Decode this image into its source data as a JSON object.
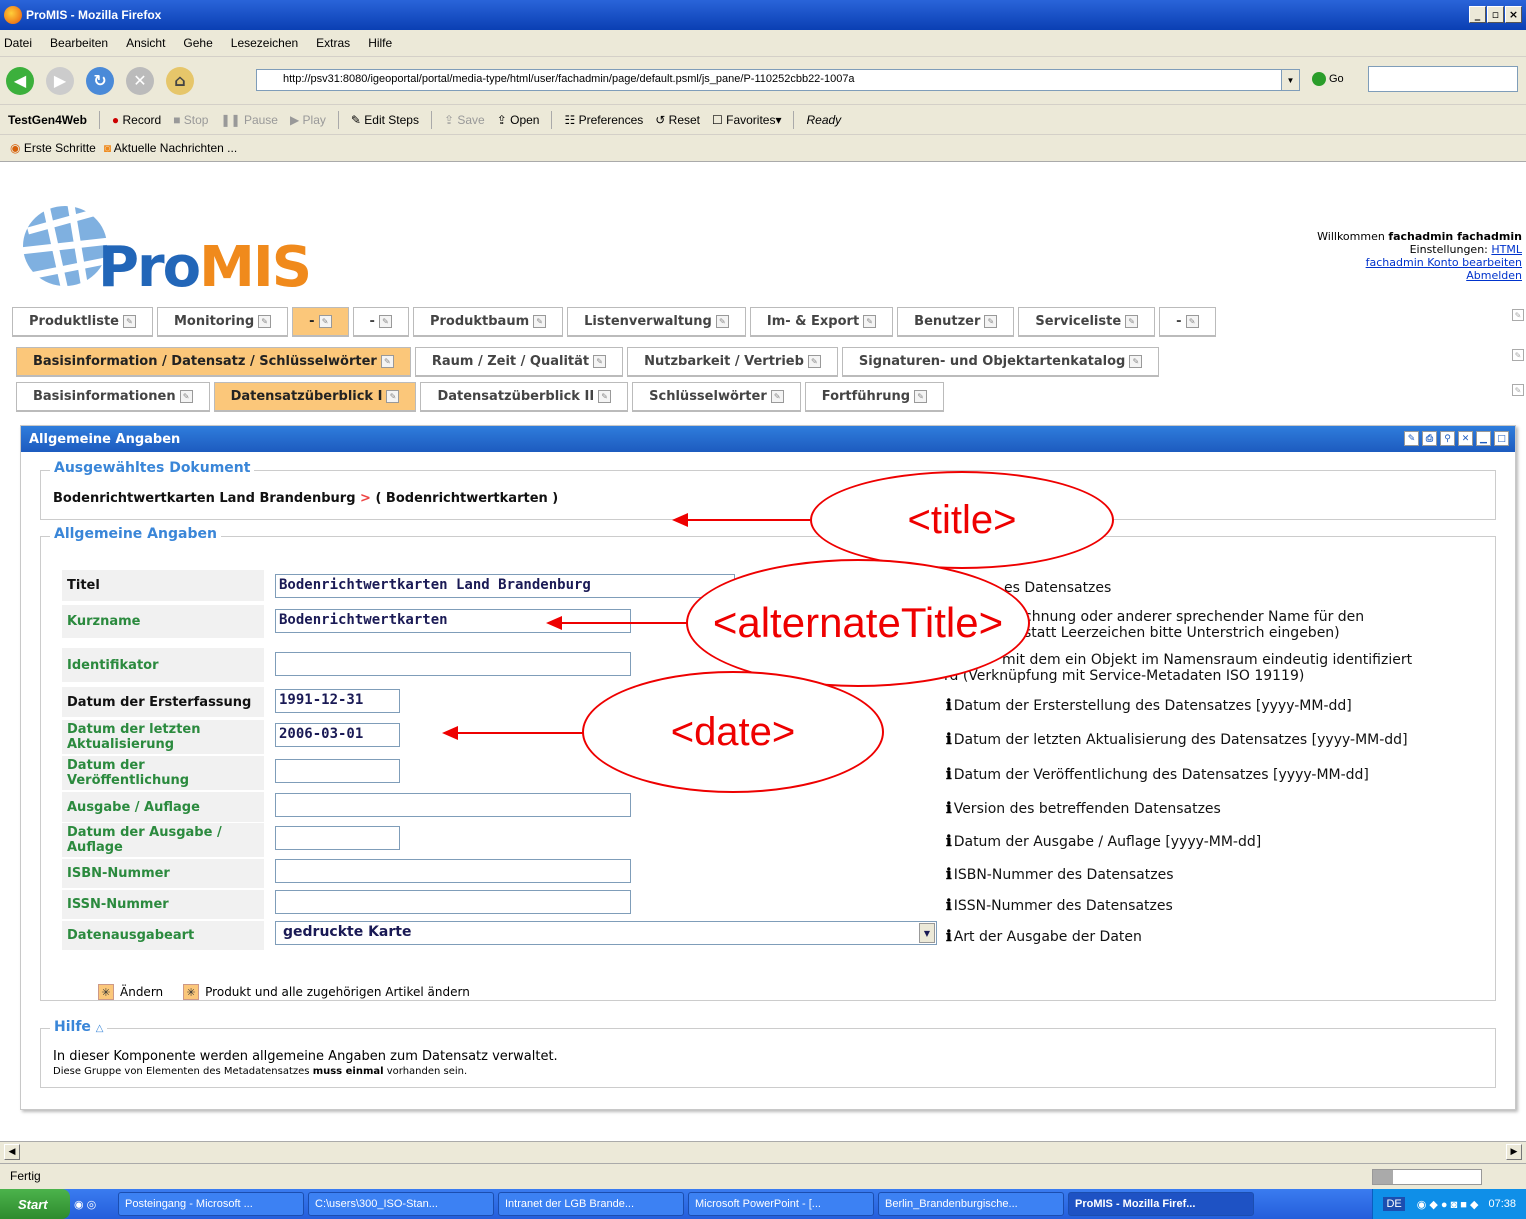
{
  "browser": {
    "title": "ProMIS - Mozilla Firefox",
    "menu": [
      "Datei",
      "Bearbeiten",
      "Ansicht",
      "Gehe",
      "Lesezeichen",
      "Extras",
      "Hilfe"
    ],
    "url": "http://psv31:8080/igeoportal/portal/media-type/html/user/fachadmin/page/default.psml/js_pane/P-110252cbb22-1007a",
    "go_label": "Go",
    "testgen": {
      "name": "TestGen4Web",
      "record": "Record",
      "stop": "Stop",
      "pause": "Pause",
      "play": "Play",
      "edit_steps": "Edit Steps",
      "save": "Save",
      "open": "Open",
      "preferences": "Preferences",
      "reset": "Reset",
      "favorites": "Favorites▾",
      "status": "Ready"
    },
    "bookmarks": [
      "Erste Schritte",
      "Aktuelle Nachrichten ..."
    ],
    "status": "Fertig"
  },
  "app": {
    "logo_pre": "Pro",
    "logo_post": "MIS",
    "welcome_prefix": "Willkommen ",
    "welcome_user": "fachadmin fachadmin",
    "settings_prefix": "Einstellungen: ",
    "settings_link": "HTML",
    "account_link": "fachadmin Konto bearbeiten",
    "logout_link": "Abmelden"
  },
  "tabs1": [
    "Produktliste",
    "Monitoring",
    "-",
    "-",
    "Produktbaum",
    "Listenverwaltung",
    "Im- & Export",
    "Benutzer",
    "Serviceliste",
    "-"
  ],
  "tabs2": [
    "Basisinformation / Datensatz / Schlüsselwörter",
    "Raum / Zeit / Qualität",
    "Nutzbarkeit / Vertrieb",
    "Signaturen- und Objektartenkatalog"
  ],
  "tabs3": [
    "Basisinformationen",
    "Datensatzüberblick I",
    "Datensatzüberblick II",
    "Schlüsselwörter",
    "Fortführung"
  ],
  "panel": {
    "title": "Allgemeine Angaben",
    "selected_legend": "Ausgewähltes Dokument",
    "doc_title": "Bodenrichtwertkarten Land Brandenburg",
    "doc_sep": ">",
    "doc_sub": "( Bodenrichtwertkarten )",
    "general_legend": "Allgemeine Angaben",
    "fields": [
      {
        "label": "Titel",
        "value": "Bodenrichtwertkarten Land Brandenburg",
        "hint": "es Datensatzes"
      },
      {
        "label": "Kurzname",
        "value": "Bodenrichtwertkarten",
        "hint1": "chnung oder anderer sprechender Name für den",
        "hint2": "statt Leerzeichen bitte Unterstrich eingeben)"
      },
      {
        "label": "Identifikator",
        "value": "",
        "hint1": "mit dem ein Objekt im Namensraum eindeutig identifiziert",
        "hint2": "rd (Verknüpfung mit Service-Metadaten ISO 19119)"
      },
      {
        "label": "Datum der Ersterfassung",
        "value": "1991-12-31",
        "hint": "Datum der Ersterstellung des Datensatzes [yyyy-MM-dd]"
      },
      {
        "label": "Datum der letzten Aktualisierung",
        "value": "2006-03-01",
        "hint": "Datum der letzten Aktualisierung des Datensatzes [yyyy-MM-dd]"
      },
      {
        "label": "Datum der Veröffentlichung",
        "value": "",
        "hint": "Datum der Veröffentlichung des Datensatzes [yyyy-MM-dd]"
      },
      {
        "label": "Ausgabe / Auflage",
        "value": "",
        "hint": "Version des betreffenden Datensatzes"
      },
      {
        "label": "Datum der Ausgabe / Auflage",
        "value": "",
        "hint": "Datum der Ausgabe / Auflage [yyyy-MM-dd]"
      },
      {
        "label": "ISBN-Nummer",
        "value": "",
        "hint": "ISBN-Nummer des Datensatzes"
      },
      {
        "label": "ISSN-Nummer",
        "value": "",
        "hint": "ISSN-Nummer des Datensatzes"
      },
      {
        "label": "Datenausgabeart",
        "value": "gedruckte Karte",
        "hint": "Art der Ausgabe der Daten"
      }
    ],
    "info_glyph": "ℹ",
    "action_change": "Ändern",
    "action_change_all": "Produkt und alle zugehörigen Artikel ändern",
    "help_legend": "Hilfe",
    "help_line1": "In dieser Komponente werden allgemeine Angaben zum Datensatz verwaltet.",
    "help_line2_pre": "Diese Gruppe von Elementen des Metadatensatzes ",
    "help_line2_bold": "muss einmal",
    "help_line2_post": " vorhanden sein."
  },
  "annotations": [
    "<title>",
    "<alternateTitle>",
    "<date>"
  ],
  "taskbar": {
    "start": "Start",
    "tasks": [
      "Posteingang - Microsoft ...",
      "C:\\users\\300_ISO-Stan...",
      "Intranet der LGB Brande...",
      "Microsoft PowerPoint - [...",
      "Berlin_Brandenburgische...",
      "ProMIS - Mozilla Firef..."
    ],
    "lang": "DE",
    "clock": "07:38"
  },
  "colors": {
    "accent": "#2f7ddc",
    "selected_tab": "#fbc77a",
    "label_green": "#2b8a3e",
    "annotation_red": "#e00000"
  }
}
